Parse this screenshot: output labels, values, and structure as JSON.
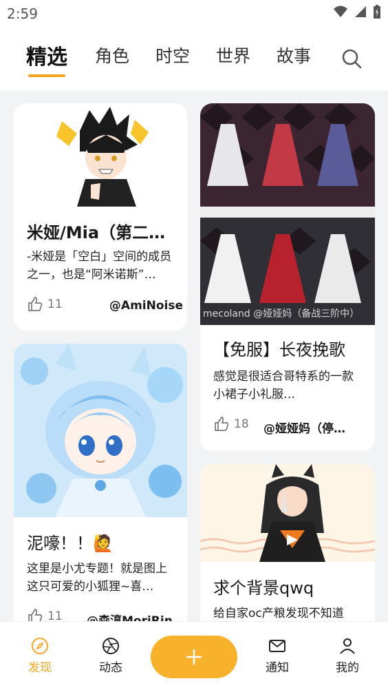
{
  "status": {
    "time": "2:59"
  },
  "tabs": [
    {
      "label": "精选"
    },
    {
      "label": "角色"
    },
    {
      "label": "时空"
    },
    {
      "label": "世界"
    },
    {
      "label": "故事"
    }
  ],
  "cards": [
    {
      "title": "米娅/Mia（第二…",
      "desc": "-米娅是「空白」空间的成员之一，也是“阿米诺斯”…",
      "likes": "11",
      "author": "@AmiNoise"
    },
    {
      "title": "【免服】长夜挽歌",
      "desc": "感觉是很适合哥特系的一款小裙子小礼服…",
      "likes": "18",
      "author": "@娅娅妈（停…",
      "watermark": "mecoland @娅娅妈（备战三阶中）"
    },
    {
      "title": "泥嚎！！🙋",
      "desc": "这里是小尤专题！就是图上这只可爱的小狐狸~喜…",
      "likes": "11",
      "author": "@森淳MoriRin"
    },
    {
      "title": "求个背景qwq",
      "desc": "给自家oc产粮发现不知道"
    }
  ],
  "nav": [
    {
      "label": "发现"
    },
    {
      "label": "动态"
    },
    {
      "label": "通知"
    },
    {
      "label": "我的"
    }
  ],
  "colors": {
    "accent": "#f5a623",
    "create_button": "#f7b12b"
  }
}
